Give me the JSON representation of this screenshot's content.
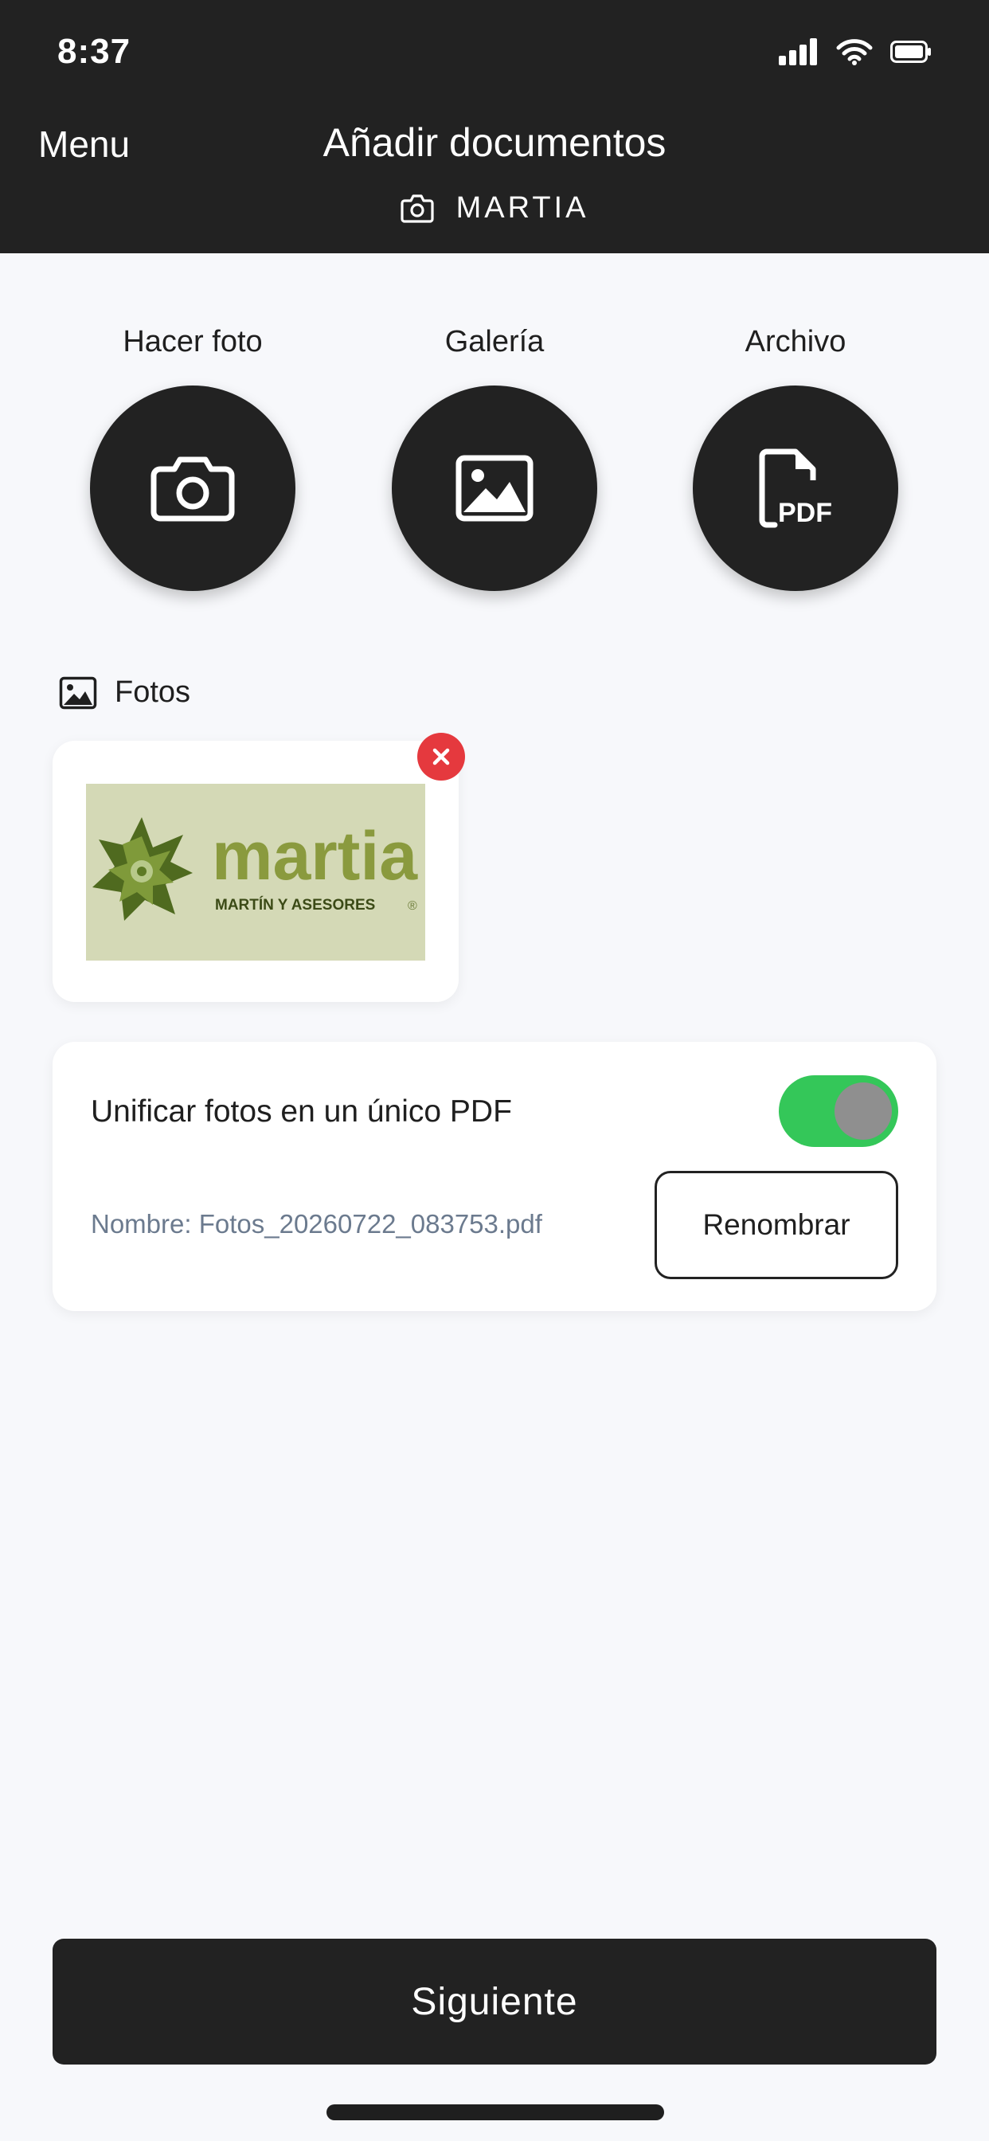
{
  "status_bar": {
    "time": "8:37"
  },
  "header": {
    "menu_label": "Menu",
    "title": "Añadir documentos",
    "subtitle": "MARTIA"
  },
  "actions": [
    {
      "label": "Hacer foto",
      "icon": "camera-icon"
    },
    {
      "label": "Galería",
      "icon": "image-icon"
    },
    {
      "label": "Archivo",
      "icon": "pdf-file-icon"
    }
  ],
  "fotos": {
    "section_label": "Fotos",
    "thumbnail": {
      "logo_text": "martia",
      "logo_subtext": "MARTÍN Y ASESORES",
      "registered_mark": "®"
    }
  },
  "unify": {
    "label": "Unificar fotos en un único PDF",
    "enabled": true,
    "filename_text": "Nombre: Fotos_20260722_083753.pdf",
    "rename_label": "Renombrar"
  },
  "footer": {
    "next_label": "Siguiente"
  },
  "colors": {
    "header_bg": "#222222",
    "page_bg": "#f7f8fb",
    "toggle_on": "#34c759",
    "remove_red": "#e5393e",
    "muted_text": "#6b7a8e",
    "thumb_bg": "#d4d9b6",
    "logo_green": "#8a9a3e"
  }
}
